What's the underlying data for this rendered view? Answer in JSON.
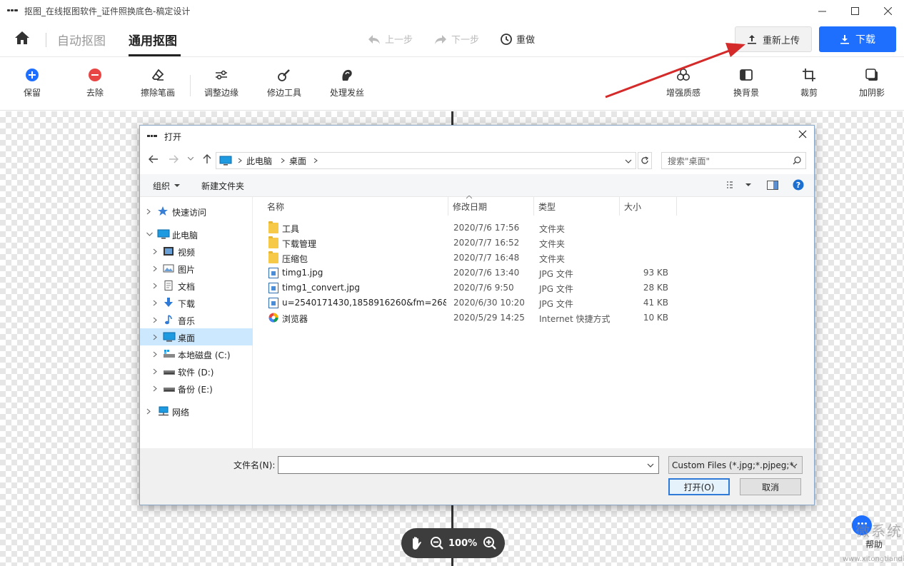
{
  "app": {
    "window_title": "抠图_在线抠图软件_证件照换底色-稿定设计"
  },
  "nav": {
    "tabs": [
      "自动抠图",
      "通用抠图"
    ],
    "undo": "上一步",
    "redo": "下一步",
    "reset": "重做",
    "reupload": "重新上传",
    "download": "下载"
  },
  "toolbar": {
    "left": [
      "保留",
      "去除",
      "擦除笔画",
      "调整边缘",
      "修边工具",
      "处理发丝"
    ],
    "right": [
      "增强质感",
      "换背景",
      "裁剪",
      "加阴影"
    ]
  },
  "zoom": {
    "value": "100%"
  },
  "help": {
    "label": "帮助"
  },
  "watermark": {
    "text": "微系统",
    "url": "www.xitongtiandi.net"
  },
  "dialog": {
    "title": "打开",
    "path": [
      "此电脑",
      "桌面"
    ],
    "search_placeholder": "搜索\"桌面\"",
    "organize": "组织",
    "new_folder": "新建文件夹",
    "nav_items": [
      {
        "label": "快速访问",
        "icon": "star-icon",
        "level": 0
      },
      {
        "label": "此电脑",
        "icon": "computer-icon",
        "level": 0
      },
      {
        "label": "视频",
        "icon": "video-icon",
        "level": 1
      },
      {
        "label": "图片",
        "icon": "picture-icon",
        "level": 1
      },
      {
        "label": "文档",
        "icon": "document-icon",
        "level": 1
      },
      {
        "label": "下载",
        "icon": "download-icon",
        "level": 1
      },
      {
        "label": "音乐",
        "icon": "music-icon",
        "level": 1
      },
      {
        "label": "桌面",
        "icon": "desktop-icon",
        "level": 1,
        "selected": true
      },
      {
        "label": "本地磁盘 (C:)",
        "icon": "drive-c-icon",
        "level": 1
      },
      {
        "label": "软件 (D:)",
        "icon": "drive-icon",
        "level": 1
      },
      {
        "label": "备份 (E:)",
        "icon": "drive-icon",
        "level": 1
      },
      {
        "label": "网络",
        "icon": "network-icon",
        "level": 0
      }
    ],
    "columns": [
      "名称",
      "修改日期",
      "类型",
      "大小"
    ],
    "files": [
      {
        "name": "工具",
        "date": "2020/7/6 17:56",
        "type": "文件夹",
        "size": "",
        "icon": "folder-icon"
      },
      {
        "name": "下载管理",
        "date": "2020/7/7 16:52",
        "type": "文件夹",
        "size": "",
        "icon": "folder-icon"
      },
      {
        "name": "压缩包",
        "date": "2020/7/7 16:48",
        "type": "文件夹",
        "size": "",
        "icon": "folder-icon"
      },
      {
        "name": "timg1.jpg",
        "date": "2020/7/6 13:40",
        "type": "JPG 文件",
        "size": "93 KB",
        "icon": "jpg-file-icon"
      },
      {
        "name": "timg1_convert.jpg",
        "date": "2020/7/6 9:50",
        "type": "JPG 文件",
        "size": "28 KB",
        "icon": "jpg-file-icon"
      },
      {
        "name": "u=2540171430,1858916260&fm=26&...",
        "date": "2020/6/30 10:20",
        "type": "JPG 文件",
        "size": "41 KB",
        "icon": "jpg-file-icon"
      },
      {
        "name": "浏览器",
        "date": "2020/5/29 14:25",
        "type": "Internet 快捷方式",
        "size": "10 KB",
        "icon": "browser-shortcut-icon"
      }
    ],
    "filename_label": "文件名(N):",
    "filename_value": "",
    "filetype": "Custom Files (*.jpg;*.pjpeg;*.",
    "open": "打开(O)",
    "cancel": "取消"
  },
  "colors": {
    "primary": "#1f6fff",
    "arrow": "#d42a2a",
    "selection": "#cce8ff"
  }
}
